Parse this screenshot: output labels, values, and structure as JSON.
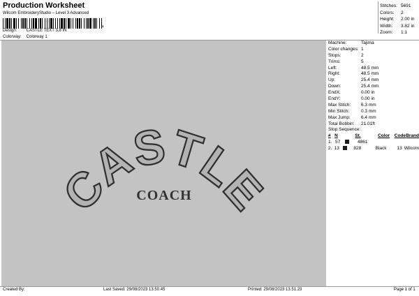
{
  "header": {
    "title": "Production Worksheet",
    "subtitle": "Wilcom EmbroideryStudio – Level 3 Advanced",
    "barcode_suffix": ","
  },
  "meta": {
    "design_label": "Design:",
    "design_value": "CASTLE TEXT 3,8 IN",
    "colorway_label": "Colorway:",
    "colorway_value": "Colorway 1"
  },
  "stats": [
    {
      "label": "Stitches:",
      "value": "5691"
    },
    {
      "label": "Colors:",
      "value": "2"
    },
    {
      "label": "Height:",
      "value": "2.00 in"
    },
    {
      "label": "Width:",
      "value": "3.82 in"
    },
    {
      "label": "Zoom:",
      "value": "1:1"
    }
  ],
  "design": {
    "line1": "CASTLE",
    "line2": "COACH",
    "fill_color": "#b3b3b3",
    "outline_color": "#2f2f2f",
    "canvas_color": "#c3c3c3"
  },
  "details": [
    {
      "label": "Machine:",
      "value": "Tajima"
    },
    {
      "label": "Color changes:",
      "value": "1"
    },
    {
      "label": "Stops:",
      "value": "2"
    },
    {
      "label": "Trims:",
      "value": "5"
    },
    {
      "label": "Left:",
      "value": "48.5 mm"
    },
    {
      "label": "Right:",
      "value": "48.5 mm"
    },
    {
      "label": "Up:",
      "value": "25.4 mm"
    },
    {
      "label": "Down:",
      "value": "25.4 mm"
    },
    {
      "label": "EndX:",
      "value": "0.00 in"
    },
    {
      "label": "EndY:",
      "value": "0.00 in"
    },
    {
      "label": "Max Stitch:",
      "value": "6.3 mm"
    },
    {
      "label": "Min Stitch:",
      "value": "0.3 mm"
    },
    {
      "label": "Max Jump:",
      "value": "6.4 mm"
    },
    {
      "label": "Total Bobbin:",
      "value": "21.01ft"
    }
  ],
  "stop_sequence": {
    "title": "Stop Sequence:",
    "headers": [
      "#",
      "N",
      "St.",
      "Color",
      "Code",
      "Brand"
    ],
    "rows": [
      {
        "num": "1.",
        "n": "57",
        "swatch": "#1a1a1a",
        "st": "4861",
        "color": "",
        "code": "",
        "brand": ""
      },
      {
        "num": "2.",
        "n": "13",
        "swatch": "#1a1a1a",
        "st": "828",
        "color": "Black",
        "code": "13",
        "brand": "Wilcom"
      }
    ]
  },
  "footer": {
    "created": "Created By:",
    "saved": "Last Saved: 29/08/2023 13.50.45",
    "printed": "Printed: 29/08/2023 13.51.23",
    "page": "Page 1 of 1"
  }
}
